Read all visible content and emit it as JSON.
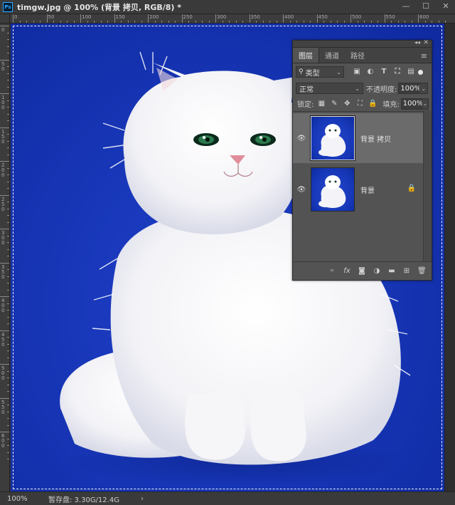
{
  "window": {
    "app_badge": "Ps",
    "document_title": "timgw.jpg @ 100% (背景 拷贝, RGB/8) *",
    "minimize": "—",
    "maximize": "☐",
    "close": "✕"
  },
  "rulers": {
    "horizontal_labels": [
      "0",
      "50",
      "100",
      "150",
      "200",
      "250",
      "300",
      "350",
      "400",
      "450",
      "500",
      "550",
      "600"
    ],
    "vertical_labels": [
      "0",
      "50",
      "100",
      "150",
      "200",
      "250",
      "300",
      "350",
      "400",
      "450",
      "500",
      "550",
      "600"
    ]
  },
  "status_bar": {
    "zoom": "100%",
    "scratch_disk": "暂存盘: 3.30G/12.4G",
    "arrow": "›"
  },
  "layers_panel": {
    "collapse_glyph": "◂◂",
    "close_glyph": "✕",
    "menu_glyph": "≡",
    "tabs": [
      {
        "label": "图层",
        "active": true
      },
      {
        "label": "通道",
        "active": false
      },
      {
        "label": "路径",
        "active": false
      }
    ],
    "filter": {
      "search_glyph": "⚲",
      "kind_label": "类型",
      "chevron": "⌄"
    },
    "filter_icons": [
      "▣",
      "◐",
      "T",
      "⛶",
      "▤"
    ],
    "blend_mode": "正常",
    "opacity_label": "不透明度:",
    "opacity_value": "100%",
    "lock_label": "锁定:",
    "lock_icons": [
      "▦",
      "✎",
      "✥",
      "⛶",
      "🔒"
    ],
    "fill_label": "填充:",
    "fill_value": "100%",
    "layers": [
      {
        "name": "背景 拷贝",
        "visible": true,
        "selected": true,
        "locked": false
      },
      {
        "name": "背景",
        "visible": true,
        "selected": false,
        "locked": true
      }
    ],
    "eye_glyph": "👁",
    "lock_glyph": "🔒",
    "bottom_icons": [
      {
        "name": "link-layers-icon",
        "glyph": "⚭"
      },
      {
        "name": "fx-icon",
        "glyph": "fx"
      },
      {
        "name": "add-mask-icon",
        "glyph": "◙"
      },
      {
        "name": "adjustment-layer-icon",
        "glyph": "◑"
      },
      {
        "name": "new-group-icon",
        "glyph": "▬"
      },
      {
        "name": "new-layer-icon",
        "glyph": "⊞"
      },
      {
        "name": "delete-layer-icon",
        "glyph": "🗑"
      }
    ]
  },
  "colors": {
    "canvas_blue": "#1736b7",
    "panel_bg": "#535353",
    "selected_layer": "#6b6b6b"
  }
}
